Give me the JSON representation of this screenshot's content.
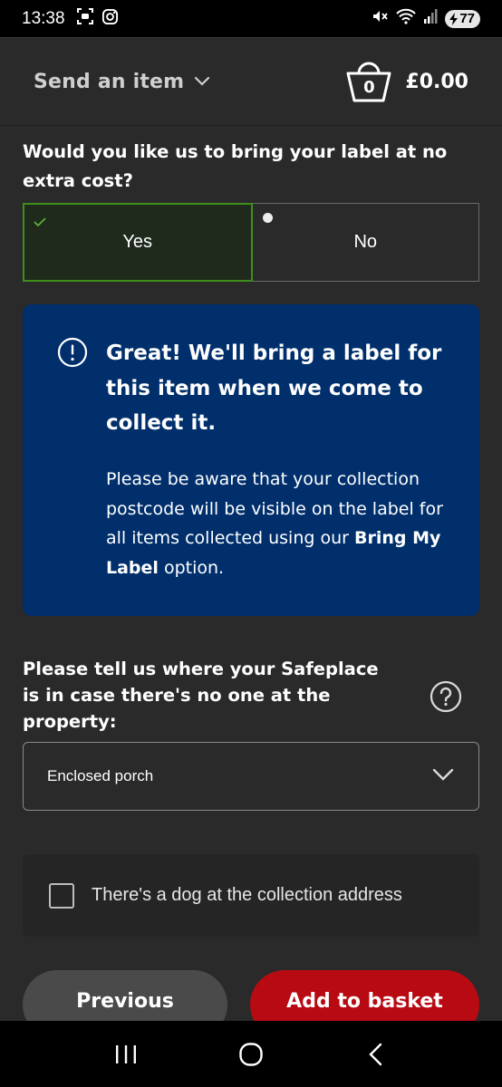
{
  "status_bar": {
    "time": "13:38",
    "battery": "77",
    "icons": [
      "screenshot-icon",
      "instagram-icon",
      "mute-icon",
      "wifi-icon",
      "signal-icon",
      "battery-icon"
    ]
  },
  "header": {
    "send_label": "Send an item",
    "basket_count": "0",
    "basket_total": "£0.00"
  },
  "label_question": {
    "text": "Would you like us to bring your label at no extra cost?",
    "options": [
      {
        "label": "Yes",
        "selected": true
      },
      {
        "label": "No",
        "selected": false
      }
    ]
  },
  "info_panel": {
    "title": "Great! We'll bring a label for this item when we come to collect it.",
    "body_prefix": "Please be aware that your collection postcode will be visible on the label for all items collected using our ",
    "body_bold": "Bring My Label",
    "body_suffix": " option."
  },
  "safeplace": {
    "label": "Please tell us where your Safeplace is in case there's no one at the property:",
    "selected_value": "Enclosed porch"
  },
  "dog": {
    "label": "There's a dog at the collection address",
    "checked": false
  },
  "buttons": {
    "previous": "Previous",
    "add_to_basket": "Add to basket"
  },
  "colors": {
    "background": "#2a2a2a",
    "selected_border": "#3f8e1c",
    "info_panel": "#002f6c",
    "primary_button": "#b80a12",
    "secondary_button": "#4a4a4a"
  }
}
